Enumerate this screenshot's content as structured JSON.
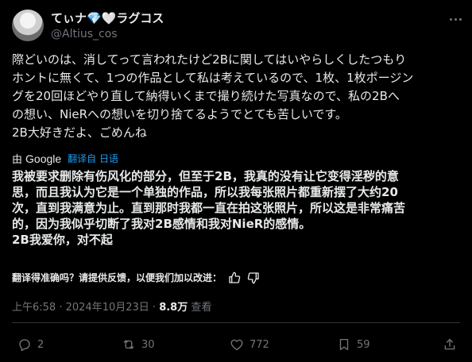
{
  "author": {
    "display_name": "てぃナ💎🤍ラグコス",
    "handle": "@Altius_cos"
  },
  "original_text": {
    "lines": [
      "際どいのは、消してって言われたけど2Bに関してはいやらしくしたつもり",
      "ホントに無くて、1つの作品として私は考えているので、1枚、1枚ポージン",
      "グを20回ほどやり直して納得いくまで撮り続けた写真なので、私の2Bへ",
      "の想い、NieRへの想いを切り捨てるようでとても苦しいです。",
      "2B大好きだよ、ごめんね"
    ]
  },
  "translation_bar": {
    "prefix": "由",
    "provider": "Google",
    "from_label": "翻译自 日语"
  },
  "translated_text": {
    "lines": [
      "我被要求删除有伤风化的部分，但至于2B，我真的没有让它变得淫秽的意",
      "思，而且我认为它是一个单独的作品，所以我每张照片都重新摆了大约20",
      "次，直到我满意为止。直到那时我都一直在拍这张照片，所以这是非常痛苦",
      "的，因为我似乎切断了我对2B感情和我对NieR的感情。",
      "2B我爱你，对不起"
    ]
  },
  "feedback": {
    "question": "翻译得准确吗？请提供反馈，以便我们加以改进："
  },
  "meta": {
    "time": "上午6:58",
    "date": "2024年10月23日",
    "separator": " · ",
    "views_count": "8.8万",
    "views_label": " 查看"
  },
  "actions": {
    "replies": "2",
    "reposts": "30",
    "likes": "772",
    "bookmarks": "59"
  },
  "colors": {
    "background": "#000000",
    "text": "#e7e9ea",
    "muted": "#71767b",
    "link": "#1d9bf0",
    "divider": "#2f3336"
  },
  "icons": [
    "more-icon",
    "thumbs-up-icon",
    "thumbs-down-icon",
    "reply-icon",
    "repost-icon",
    "like-icon",
    "bookmark-icon",
    "share-icon"
  ]
}
